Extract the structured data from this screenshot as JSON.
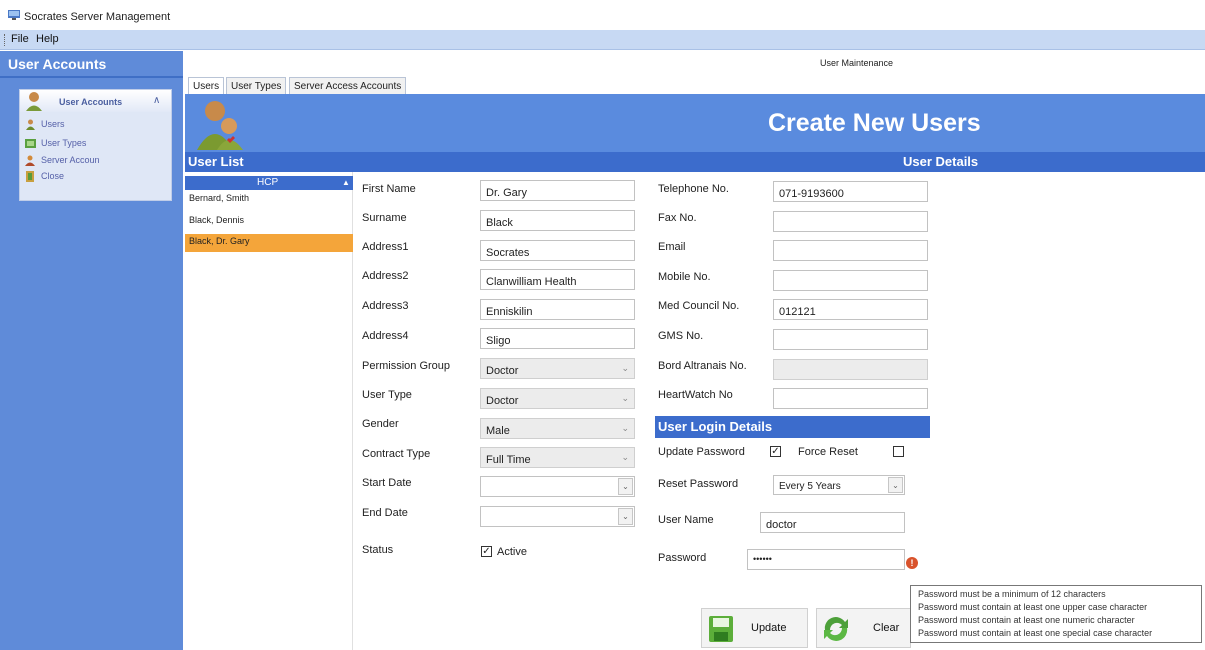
{
  "window": {
    "title": "Socrates Server Management"
  },
  "menu": [
    "File",
    "Help"
  ],
  "sidebar": {
    "title": "User Accounts",
    "panel_header": "User Accounts",
    "items": [
      {
        "label": "Users",
        "icon": "users-icon"
      },
      {
        "label": "User Types",
        "icon": "user-types-icon"
      },
      {
        "label": "Server Accoun",
        "icon": "server-access-icon"
      },
      {
        "label": "Close",
        "icon": "close-icon"
      }
    ]
  },
  "main": {
    "window_label": "User Maintenance",
    "tabs": [
      "Users",
      "User Types",
      "Server Access Accounts"
    ],
    "banner_title": "Create New Users",
    "user_list_title": "User List",
    "user_details_title": "User Details"
  },
  "user_list": {
    "column_header": "HCP",
    "rows": [
      "Bernard, Smith",
      "Black, Dennis",
      "Black, Dr. Gary"
    ],
    "selected_index": 2
  },
  "form_left": [
    {
      "label": "First Name",
      "value": "Dr. Gary",
      "type": "text"
    },
    {
      "label": "Surname",
      "value": "Black",
      "type": "text"
    },
    {
      "label": "Address1",
      "value": "Socrates",
      "type": "text"
    },
    {
      "label": "Address2",
      "value": "Clanwilliam Health",
      "type": "text"
    },
    {
      "label": "Address3",
      "value": "Enniskilin",
      "type": "text"
    },
    {
      "label": "Address4",
      "value": "Sligo",
      "type": "text"
    },
    {
      "label": "Permission Group",
      "value": "Doctor",
      "type": "disabled-select"
    },
    {
      "label": "User Type",
      "value": "Doctor",
      "type": "disabled-select"
    },
    {
      "label": "Gender",
      "value": "Male",
      "type": "disabled-select"
    },
    {
      "label": "Contract Type",
      "value": "Full Time",
      "type": "disabled-select"
    },
    {
      "label": "Start Date",
      "value": "",
      "type": "date"
    },
    {
      "label": "End Date",
      "value": "",
      "type": "date"
    }
  ],
  "status": {
    "label": "Status",
    "checkbox_label": "Active",
    "checked": true
  },
  "form_right": [
    {
      "label": "Telephone No.",
      "value": "071-9193600",
      "type": "text"
    },
    {
      "label": "Fax No.",
      "value": "",
      "type": "text"
    },
    {
      "label": "Email",
      "value": "",
      "type": "text"
    },
    {
      "label": "Mobile No.",
      "value": "",
      "type": "text"
    },
    {
      "label": "Med Council No.",
      "value": "012121",
      "type": "text"
    },
    {
      "label": "GMS No.",
      "value": "",
      "type": "text"
    },
    {
      "label": "Bord Altranais No.",
      "value": "",
      "type": "disabled"
    },
    {
      "label": "HeartWatch No",
      "value": "",
      "type": "text"
    }
  ],
  "login": {
    "title": "User Login Details",
    "update_password_label": "Update Password",
    "update_password_checked": true,
    "force_reset_label": "Force Reset",
    "force_reset_checked": false,
    "reset_password_label": "Reset Password",
    "reset_password_value": "Every 5 Years",
    "username_label": "User Name",
    "username_value": "doctor",
    "password_label": "Password",
    "password_value": "••••••"
  },
  "buttons": {
    "update": "Update",
    "clear": "Clear"
  },
  "tooltip": [
    "Password must be a minimum of 12 characters",
    "Password must contain at least one upper case character",
    "Password must contain at least one numeric character",
    "Password must contain at least one special case character"
  ]
}
